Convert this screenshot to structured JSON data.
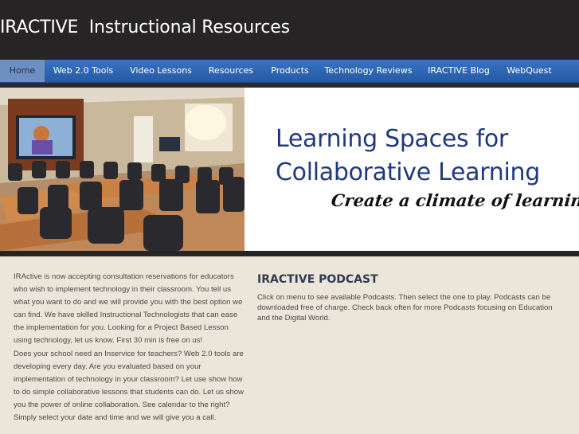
{
  "header": {
    "site_title": "IRACTIVE  Instructional Resources"
  },
  "nav": {
    "items": [
      {
        "label": "Home",
        "active": true
      },
      {
        "label": "Web 2.0 Tools"
      },
      {
        "label": "Video Lessons"
      },
      {
        "label": "Resources"
      },
      {
        "label": "Products"
      },
      {
        "label": "Technology Reviews"
      },
      {
        "label": "IRACTIVE Blog"
      },
      {
        "label": "WebQuest"
      }
    ]
  },
  "banner": {
    "headline_line1": "Learning Spaces for",
    "headline_line2": "Collaborative Learning",
    "tagline": "Create a climate of learning"
  },
  "main": {
    "left_paragraphs": [
      "IRActive is now accepting consultation reservations for educators who wish to implement technology in their classroom. You tell us what you want to do and we will provide you with the best option we can find. We have skilled Instructional Technologists that can ease the implementation for you. Looking for a Project Based Lesson using technology, let us know. First 30 min is free on us!",
      "Does your school need an Inservice for teachers? Web 2.0 tools are developing every day. Are you evaluated based on your implementation of technology in your classroom? Let use show how to do simple collaborative lessons that students can do. Let us show you the power of online collaboration. See calendar to the right? Simply select your date and time and we will give you a call."
    ],
    "podcast_title": "IRACTIVE PODCAST",
    "podcast_text": "Click on menu to see available Podcasts. Then select the one to play. Podcasts can be downloaded free of charge. Check back often for more Podcasts focusing on Education and the Digital World."
  },
  "colors": {
    "header_bg": "#262424",
    "nav_bg": "#2f66b4",
    "nav_active_bg": "#6e8fc1",
    "headline": "#1f3880",
    "content_bg": "#ece6da"
  }
}
